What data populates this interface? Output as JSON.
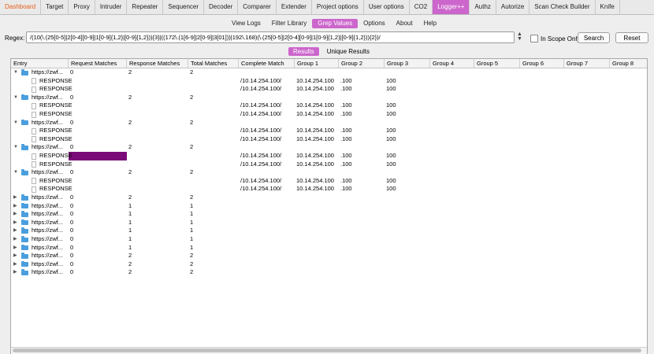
{
  "top_tabs": [
    {
      "label": "Dashboard",
      "state": "dash"
    },
    {
      "label": "Target",
      "state": ""
    },
    {
      "label": "Proxy",
      "state": ""
    },
    {
      "label": "Intruder",
      "state": ""
    },
    {
      "label": "Repeater",
      "state": ""
    },
    {
      "label": "Sequencer",
      "state": ""
    },
    {
      "label": "Decoder",
      "state": ""
    },
    {
      "label": "Comparer",
      "state": ""
    },
    {
      "label": "Extender",
      "state": ""
    },
    {
      "label": "Project options",
      "state": ""
    },
    {
      "label": "User options",
      "state": ""
    },
    {
      "label": "CO2",
      "state": ""
    },
    {
      "label": "Logger++",
      "state": "active"
    },
    {
      "label": "Authz",
      "state": ""
    },
    {
      "label": "Autorize",
      "state": ""
    },
    {
      "label": "Scan Check Builder",
      "state": ""
    },
    {
      "label": "Knife",
      "state": ""
    }
  ],
  "sub_tabs": [
    {
      "label": "View Logs",
      "active": false
    },
    {
      "label": "Filter Library",
      "active": false
    },
    {
      "label": "Grep Values",
      "active": true
    },
    {
      "label": "Options",
      "active": false
    },
    {
      "label": "About",
      "active": false
    },
    {
      "label": "Help",
      "active": false
    }
  ],
  "regex": {
    "label": "Regex:",
    "value": "/(10(\\.(25[0-5]|2[0-4][0-9]|1[0-9]{1,2}|[0-9]{1,2})){3}|((172\\.(1[6-9]|2[0-9]|3[01]))|192\\.168)(\\.(25[0-5]|2[0-4][0-9]|1[0-9]{1,2}|[0-9]{1,2})){2})/"
  },
  "scope_label": "In Scope Only",
  "search_label": "Search",
  "reset_label": "Reset",
  "result_tabs": [
    {
      "label": "Results",
      "active": true
    },
    {
      "label": "Unique Results",
      "active": false
    }
  ],
  "colors": {
    "accent": "#cc66cc",
    "selection": "#7a0a78",
    "folder": "#4a9ede",
    "dashboard": "#e8601c"
  },
  "columns": [
    "Entry",
    "Request Matches",
    "Response Matches",
    "Total Matches",
    "Complete Match",
    "Group 1",
    "Group 2",
    "Group 3",
    "Group 4",
    "Group 5",
    "Group 6",
    "Group 7",
    "Group 8"
  ],
  "rows": [
    {
      "type": "parent",
      "expanded": true,
      "entry": "https://zwf...",
      "req": "0",
      "resp": "2",
      "total": "2"
    },
    {
      "type": "child",
      "entry": "RESPONSE",
      "complete": "/10.14.254.100/",
      "g1": "10.14.254.100",
      "g2": ".100",
      "g3": "100"
    },
    {
      "type": "child",
      "entry": "RESPONSE",
      "complete": "/10.14.254.100/",
      "g1": "10.14.254.100",
      "g2": ".100",
      "g3": "100"
    },
    {
      "type": "parent",
      "expanded": true,
      "entry": "https://zwf...",
      "req": "0",
      "resp": "2",
      "total": "2"
    },
    {
      "type": "child",
      "entry": "RESPONSE",
      "complete": "/10.14.254.100/",
      "g1": "10.14.254.100",
      "g2": ".100",
      "g3": "100"
    },
    {
      "type": "child",
      "entry": "RESPONSE",
      "complete": "/10.14.254.100/",
      "g1": "10.14.254.100",
      "g2": ".100",
      "g3": "100"
    },
    {
      "type": "parent",
      "expanded": true,
      "entry": "https://zwf...",
      "req": "0",
      "resp": "2",
      "total": "2"
    },
    {
      "type": "child",
      "entry": "RESPONSE",
      "complete": "/10.14.254.100/",
      "g1": "10.14.254.100",
      "g2": ".100",
      "g3": "100"
    },
    {
      "type": "child",
      "entry": "RESPONSE",
      "complete": "/10.14.254.100/",
      "g1": "10.14.254.100",
      "g2": ".100",
      "g3": "100"
    },
    {
      "type": "parent",
      "expanded": true,
      "entry": "https://zwf...",
      "req": "0",
      "resp": "2",
      "total": "2"
    },
    {
      "type": "child",
      "entry": "RESPONSE",
      "selected": true,
      "complete": "/10.14.254.100/",
      "g1": "10.14.254.100",
      "g2": ".100",
      "g3": "100"
    },
    {
      "type": "child",
      "entry": "RESPONSE",
      "complete": "/10.14.254.100/",
      "g1": "10.14.254.100",
      "g2": ".100",
      "g3": "100"
    },
    {
      "type": "parent",
      "expanded": true,
      "entry": "https://zwf...",
      "req": "0",
      "resp": "2",
      "total": "2"
    },
    {
      "type": "child",
      "entry": "RESPONSE",
      "complete": "/10.14.254.100/",
      "g1": "10.14.254.100",
      "g2": ".100",
      "g3": "100"
    },
    {
      "type": "child",
      "entry": "RESPONSE",
      "complete": "/10.14.254.100/",
      "g1": "10.14.254.100",
      "g2": ".100",
      "g3": "100"
    },
    {
      "type": "parent",
      "expanded": false,
      "entry": "https://zwf...",
      "req": "0",
      "resp": "2",
      "total": "2"
    },
    {
      "type": "parent",
      "expanded": false,
      "entry": "https://zwf...",
      "req": "0",
      "resp": "1",
      "total": "1"
    },
    {
      "type": "parent",
      "expanded": false,
      "entry": "https://zwf...",
      "req": "0",
      "resp": "1",
      "total": "1"
    },
    {
      "type": "parent",
      "expanded": false,
      "entry": "https://zwf...",
      "req": "0",
      "resp": "1",
      "total": "1"
    },
    {
      "type": "parent",
      "expanded": false,
      "entry": "https://zwf...",
      "req": "0",
      "resp": "1",
      "total": "1"
    },
    {
      "type": "parent",
      "expanded": false,
      "entry": "https://zwf...",
      "req": "0",
      "resp": "1",
      "total": "1"
    },
    {
      "type": "parent",
      "expanded": false,
      "entry": "https://zwf...",
      "req": "0",
      "resp": "1",
      "total": "1"
    },
    {
      "type": "parent",
      "expanded": false,
      "entry": "https://zwf...",
      "req": "0",
      "resp": "2",
      "total": "2"
    },
    {
      "type": "parent",
      "expanded": false,
      "entry": "https://zwf...",
      "req": "0",
      "resp": "2",
      "total": "2"
    },
    {
      "type": "parent",
      "expanded": false,
      "entry": "https://zwf...",
      "req": "0",
      "resp": "2",
      "total": "2"
    }
  ]
}
